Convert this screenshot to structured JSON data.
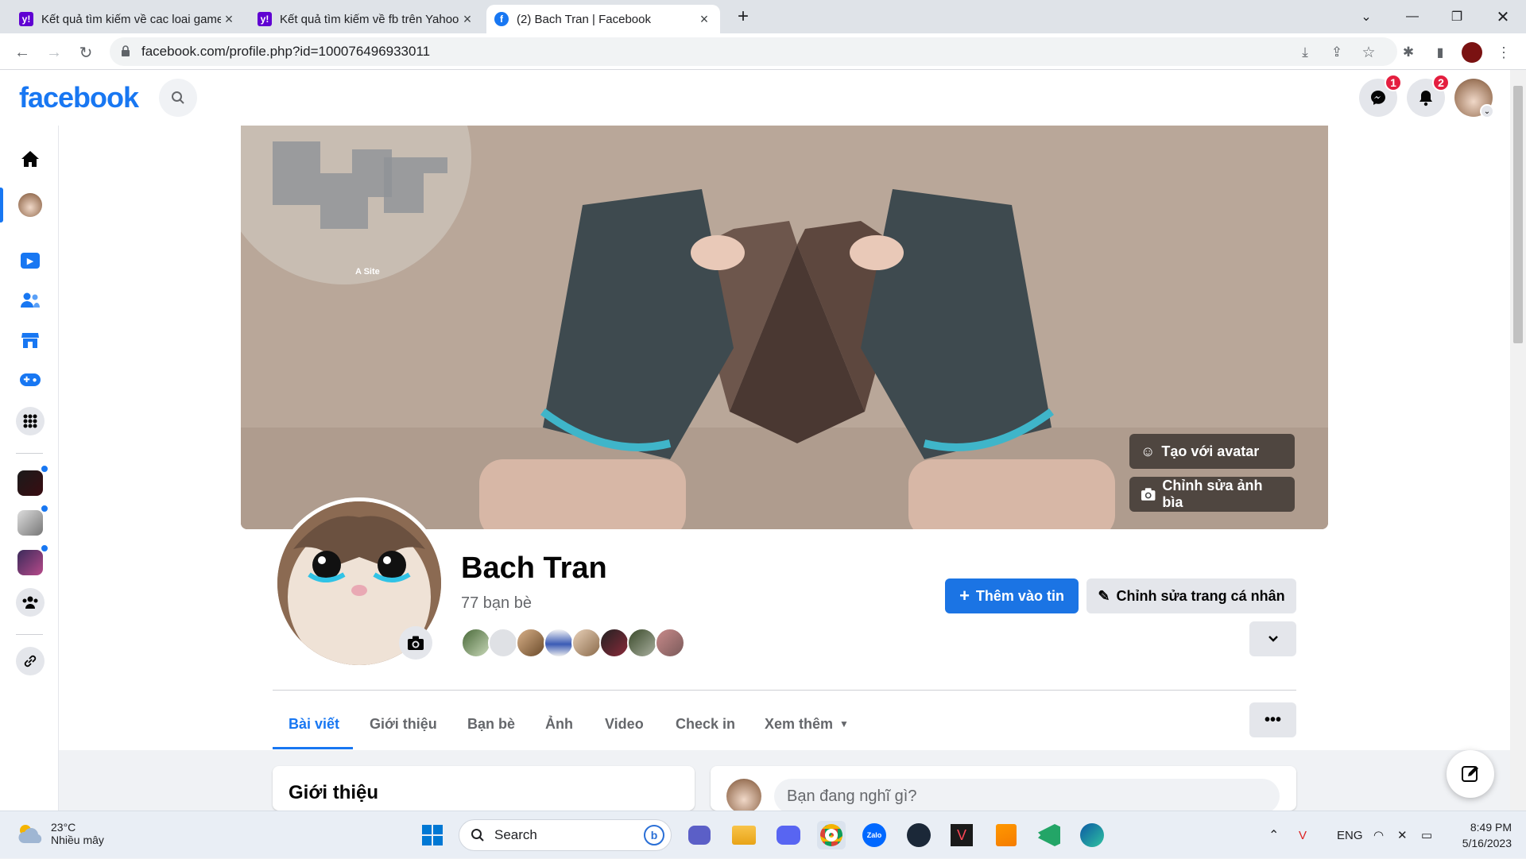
{
  "browser": {
    "tabs": [
      {
        "title": "Kết quả tìm kiếm về cac loai game",
        "favicon": "y!"
      },
      {
        "title": "Kết quả tìm kiếm về fb trên Yahoo",
        "favicon": "y!"
      },
      {
        "title": "(2) Bach Tran | Facebook",
        "favicon": "f"
      }
    ],
    "url": "facebook.com/profile.php?id=100076496933011"
  },
  "fb": {
    "logo": "facebook",
    "messenger_badge": "1",
    "notif_badge": "2"
  },
  "cover": {
    "map_label": "A Site",
    "avatar_btn": "Tạo với avatar",
    "edit_cover_btn": "Chỉnh sửa ảnh bìa"
  },
  "profile": {
    "name": "Bach Tran",
    "friends_count": "77 bạn bè",
    "add_story": "Thêm vào tin",
    "edit_profile": "Chỉnh sửa trang cá nhân"
  },
  "tabs": [
    "Bài viết",
    "Giới thiệu",
    "Bạn bè",
    "Ảnh",
    "Video",
    "Check in",
    "Xem thêm"
  ],
  "intro": {
    "title": "Giới thiệu"
  },
  "composer": {
    "placeholder": "Bạn đang nghĩ gì?"
  },
  "taskbar": {
    "weather_temp": "23°C",
    "weather_desc": "Nhiều mây",
    "search": "Search",
    "lang": "ENG",
    "time": "8:49 PM",
    "date": "5/16/2023"
  },
  "colors": {
    "fb_blue": "#1877f2",
    "badge_red": "#e41e3f"
  }
}
